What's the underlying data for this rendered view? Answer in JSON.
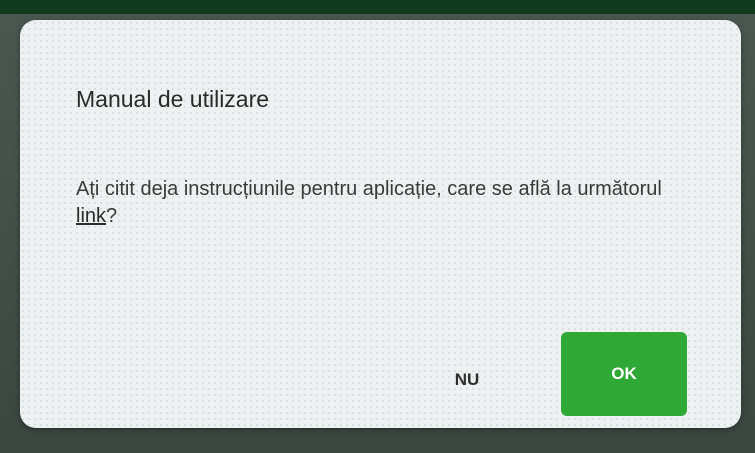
{
  "dialog": {
    "title": "Manual de utilizare",
    "message_before_link": "Ați citit deja instrucțiunile pentru aplicație, care se află la următorul ",
    "link_text": "link",
    "message_after_link": "?",
    "buttons": {
      "no_label": "NU",
      "ok_label": "OK"
    }
  },
  "colors": {
    "ok_button": "#2fa836",
    "dialog_background": "#eef1f2",
    "top_strip": "#0f3a1c"
  }
}
